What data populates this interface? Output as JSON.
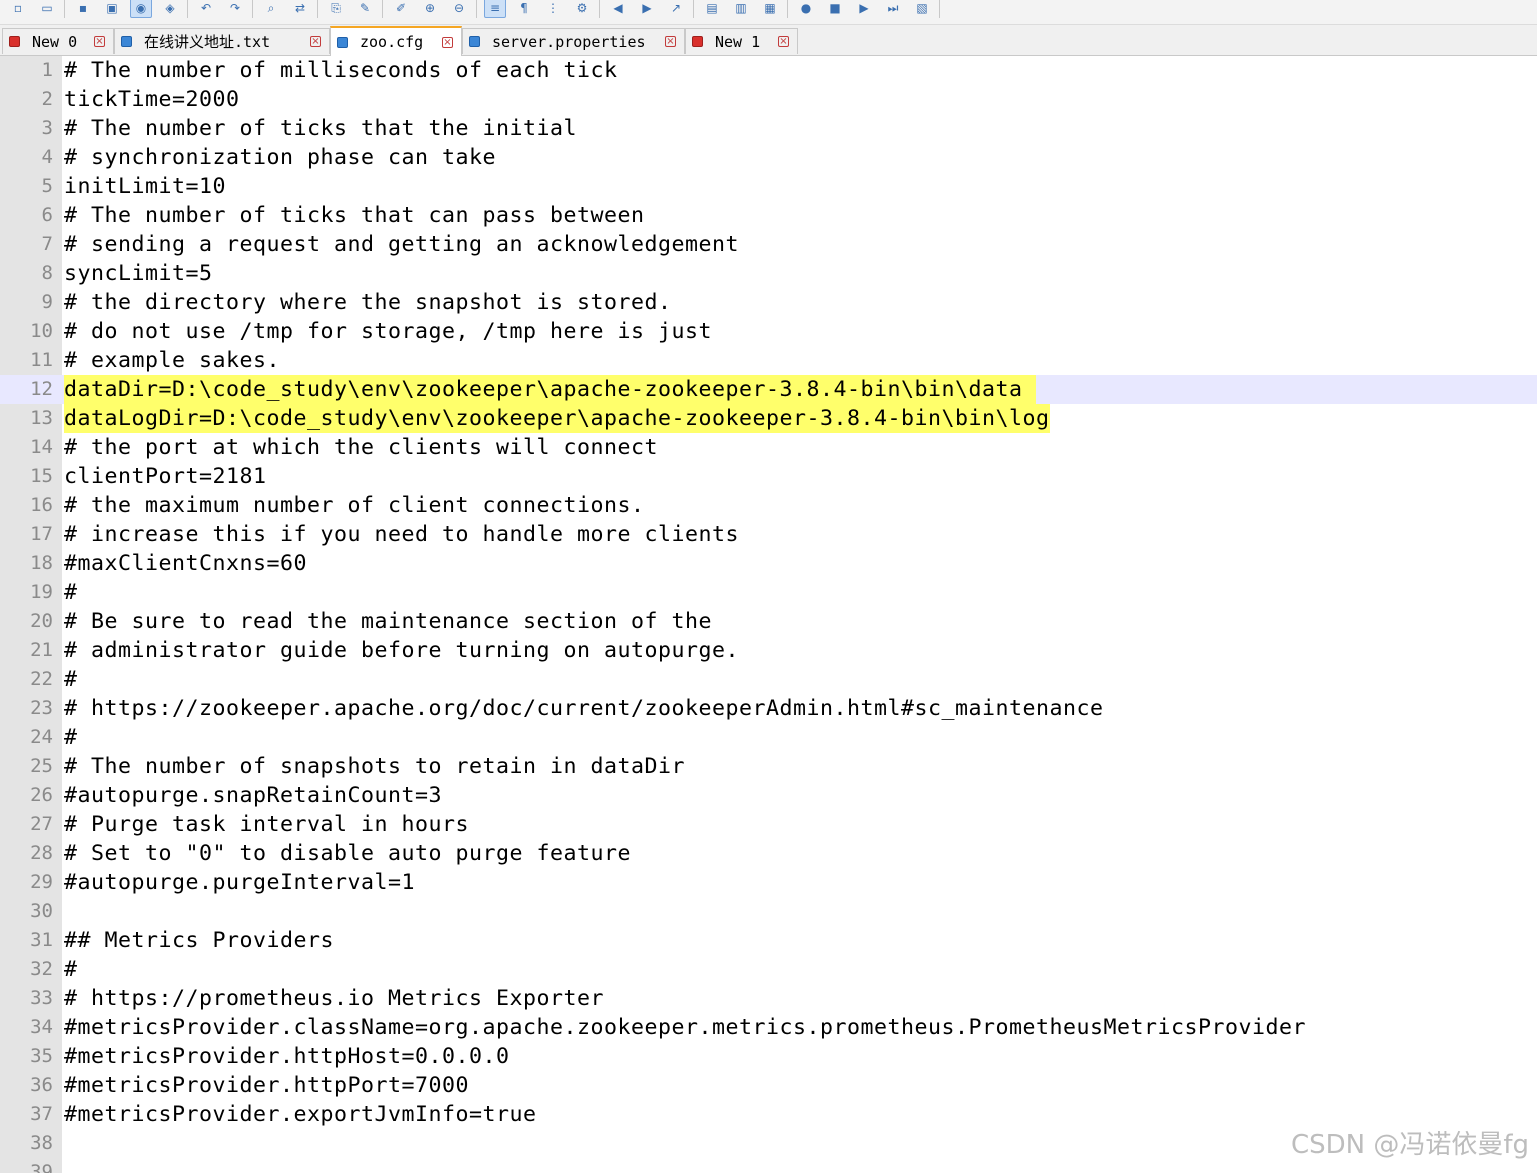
{
  "toolbar": {
    "buttons": [
      {
        "icon": "new-file-icon",
        "glyph": "▫"
      },
      {
        "icon": "open-file-icon",
        "glyph": "▭"
      },
      {
        "icon": "save-icon",
        "glyph": "▪"
      },
      {
        "icon": "save-all-icon",
        "glyph": "▣"
      },
      {
        "icon": "close-icon",
        "glyph": "◉"
      },
      {
        "icon": "close-all-icon",
        "glyph": "◈"
      },
      {
        "icon": "undo-icon",
        "glyph": "↶"
      },
      {
        "icon": "redo-icon",
        "glyph": "↷"
      },
      {
        "icon": "find-icon",
        "glyph": "⌕"
      },
      {
        "icon": "replace-icon",
        "glyph": "⇄"
      },
      {
        "icon": "sync-scroll-icon",
        "glyph": "⎘"
      },
      {
        "icon": "macro-icon",
        "glyph": "✎"
      },
      {
        "icon": "eraser-icon",
        "glyph": "✐"
      },
      {
        "icon": "zoom-in-icon",
        "glyph": "⊕"
      },
      {
        "icon": "zoom-out-icon",
        "glyph": "⊖"
      },
      {
        "icon": "word-wrap-icon",
        "glyph": "≡"
      },
      {
        "icon": "show-all-characters-icon",
        "glyph": "¶"
      },
      {
        "icon": "indent-guide-icon",
        "glyph": "⋮"
      },
      {
        "icon": "settings-icon",
        "glyph": "⚙"
      },
      {
        "icon": "prev-icon",
        "glyph": "◀"
      },
      {
        "icon": "next-icon",
        "glyph": "▶"
      },
      {
        "icon": "go-icon",
        "glyph": "↗"
      },
      {
        "icon": "doc-map-icon",
        "glyph": "▤"
      },
      {
        "icon": "function-list-icon",
        "glyph": "▥"
      },
      {
        "icon": "monitor-icon",
        "glyph": "▦"
      },
      {
        "icon": "record-macro-icon",
        "glyph": "●"
      },
      {
        "icon": "stop-macro-icon",
        "glyph": "■"
      },
      {
        "icon": "play-macro-icon",
        "glyph": "▶"
      },
      {
        "icon": "run-macro-multiple-icon",
        "glyph": "⏭"
      },
      {
        "icon": "save-macro-icon",
        "glyph": "▧"
      }
    ]
  },
  "tabs": [
    {
      "label": "New 0",
      "state": "unsaved",
      "active": false
    },
    {
      "label": "在线讲义地址.txt",
      "state": "saved",
      "active": false
    },
    {
      "label": "zoo.cfg",
      "state": "saved",
      "active": true
    },
    {
      "label": "server.properties",
      "state": "saved",
      "active": false
    },
    {
      "label": "New 1",
      "state": "unsaved",
      "active": false
    }
  ],
  "tab_close_glyph": "×",
  "editor": {
    "current_line": 12,
    "highlighted_lines": [
      12,
      13
    ],
    "lines": [
      "# The number of milliseconds of each tick",
      "tickTime=2000",
      "# The number of ticks that the initial",
      "# synchronization phase can take",
      "initLimit=10",
      "# The number of ticks that can pass between",
      "# sending a request and getting an acknowledgement",
      "syncLimit=5",
      "# the directory where the snapshot is stored.",
      "# do not use /tmp for storage, /tmp here is just",
      "# example sakes.",
      "dataDir=D:\\code_study\\env\\zookeeper\\apache-zookeeper-3.8.4-bin\\bin\\data ",
      "dataLogDir=D:\\code_study\\env\\zookeeper\\apache-zookeeper-3.8.4-bin\\bin\\log",
      "# the port at which the clients will connect",
      "clientPort=2181",
      "# the maximum number of client connections.",
      "# increase this if you need to handle more clients",
      "#maxClientCnxns=60",
      "#",
      "# Be sure to read the maintenance section of the",
      "# administrator guide before turning on autopurge.",
      "#",
      "# https://zookeeper.apache.org/doc/current/zookeeperAdmin.html#sc_maintenance",
      "#",
      "# The number of snapshots to retain in dataDir",
      "#autopurge.snapRetainCount=3",
      "# Purge task interval in hours",
      "# Set to \"0\" to disable auto purge feature",
      "#autopurge.purgeInterval=1",
      "",
      "## Metrics Providers",
      "#",
      "# https://prometheus.io Metrics Exporter",
      "#metricsProvider.className=org.apache.zookeeper.metrics.prometheus.PrometheusMetricsProvider",
      "#metricsProvider.httpHost=0.0.0.0",
      "#metricsProvider.httpPort=7000",
      "#metricsProvider.exportJvmInfo=true",
      "",
      ""
    ]
  },
  "watermark": "CSDN @冯诺依曼fg"
}
